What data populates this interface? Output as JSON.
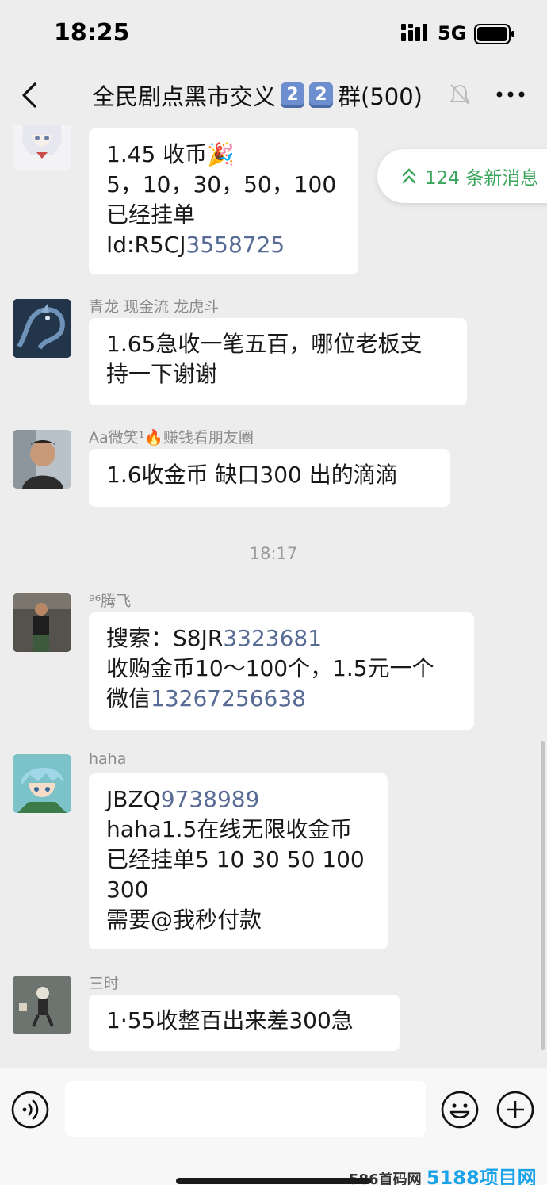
{
  "status": {
    "time": "18:25",
    "network": "5G"
  },
  "header": {
    "title_prefix": "全民剧点黑市交义",
    "keycap1": "2",
    "keycap2": "2",
    "title_suffix": "群(500)"
  },
  "new_messages": {
    "label": "124 条新消息",
    "color": "#3aa55a"
  },
  "messages": [
    {
      "sender": "",
      "lines": [
        "1.45 收币🎉",
        "5，10，30，50，100",
        "已经挂单"
      ],
      "id_prefix": "Id:R5CJ",
      "id_number": "3558725"
    },
    {
      "sender": "青龙 现金流 龙虎斗",
      "lines": [
        "1.65急收一笔五百，哪位老板支",
        "持一下谢谢"
      ]
    },
    {
      "sender": "Aa微笑¹🔥赚钱看朋友圈",
      "lines": [
        "1.6收金币  缺口300  出的滴滴"
      ]
    },
    {
      "sender": "⁹⁶腾飞",
      "search_prefix": "搜索：S8JR",
      "search_number": "3323681",
      "line2": "收购金币10～100个，1.5元一个",
      "wechat_prefix": "微信",
      "wechat_number": "13267256638"
    },
    {
      "sender": "haha",
      "id_prefix": "JBZQ",
      "id_number": "9738989",
      "lines": [
        "haha1.5在线无限收金币",
        "已经挂单5 10 30 50 100",
        "300",
        "需要@我秒付款"
      ]
    },
    {
      "sender": "三时",
      "lines": [
        "1·55收整百出来差300急"
      ]
    }
  ],
  "time_divider": "18:17",
  "watermark": {
    "text": "586首码网",
    "brand": "5188项目网"
  },
  "colors": {
    "link": "#576b95",
    "background": "#ededed",
    "bubble": "#ffffff"
  },
  "icons": [
    "back-icon",
    "mute-icon",
    "more-icon",
    "voice-icon",
    "emoji-icon",
    "plus-icon",
    "double-chevron-up-icon"
  ]
}
